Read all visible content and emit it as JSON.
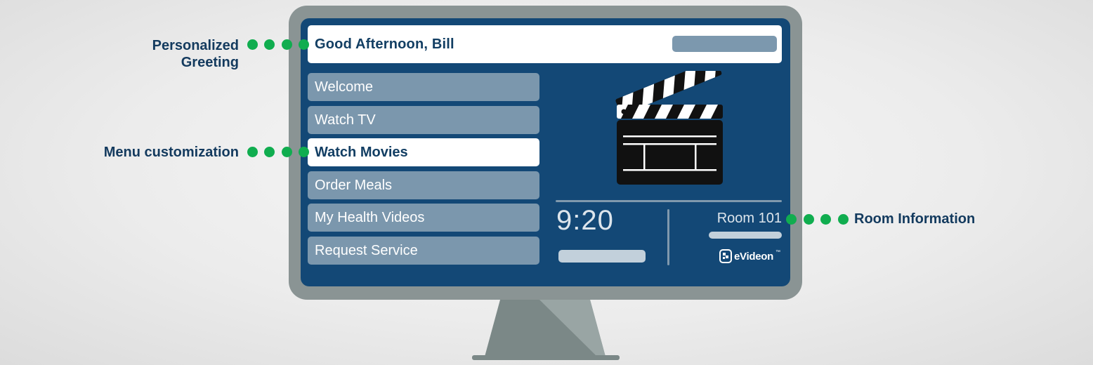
{
  "screen": {
    "greeting": "Good Afternoon, Bill",
    "menu": [
      {
        "label": "Welcome",
        "active": false
      },
      {
        "label": "Watch TV",
        "active": false
      },
      {
        "label": "Watch Movies",
        "active": true
      },
      {
        "label": "Order Meals",
        "active": false
      },
      {
        "label": "My Health Videos",
        "active": false
      },
      {
        "label": "Request Service",
        "active": false
      }
    ],
    "media_icon": "clapperboard-icon",
    "time": "9:20",
    "room": "Room 101",
    "brand": {
      "name": "eVideon",
      "tm": "™",
      "icon": "evideon-logo-icon"
    }
  },
  "callouts": {
    "greeting_line1": "Personalized",
    "greeting_line2": "Greeting",
    "menu": "Menu customization",
    "room": "Room Information"
  },
  "colors": {
    "screen_bg": "#134876",
    "menu_inactive": "#7b97ad",
    "callout_dot": "#10ad4f",
    "callout_text": "#133a5e",
    "bezel": "#8a9494"
  }
}
